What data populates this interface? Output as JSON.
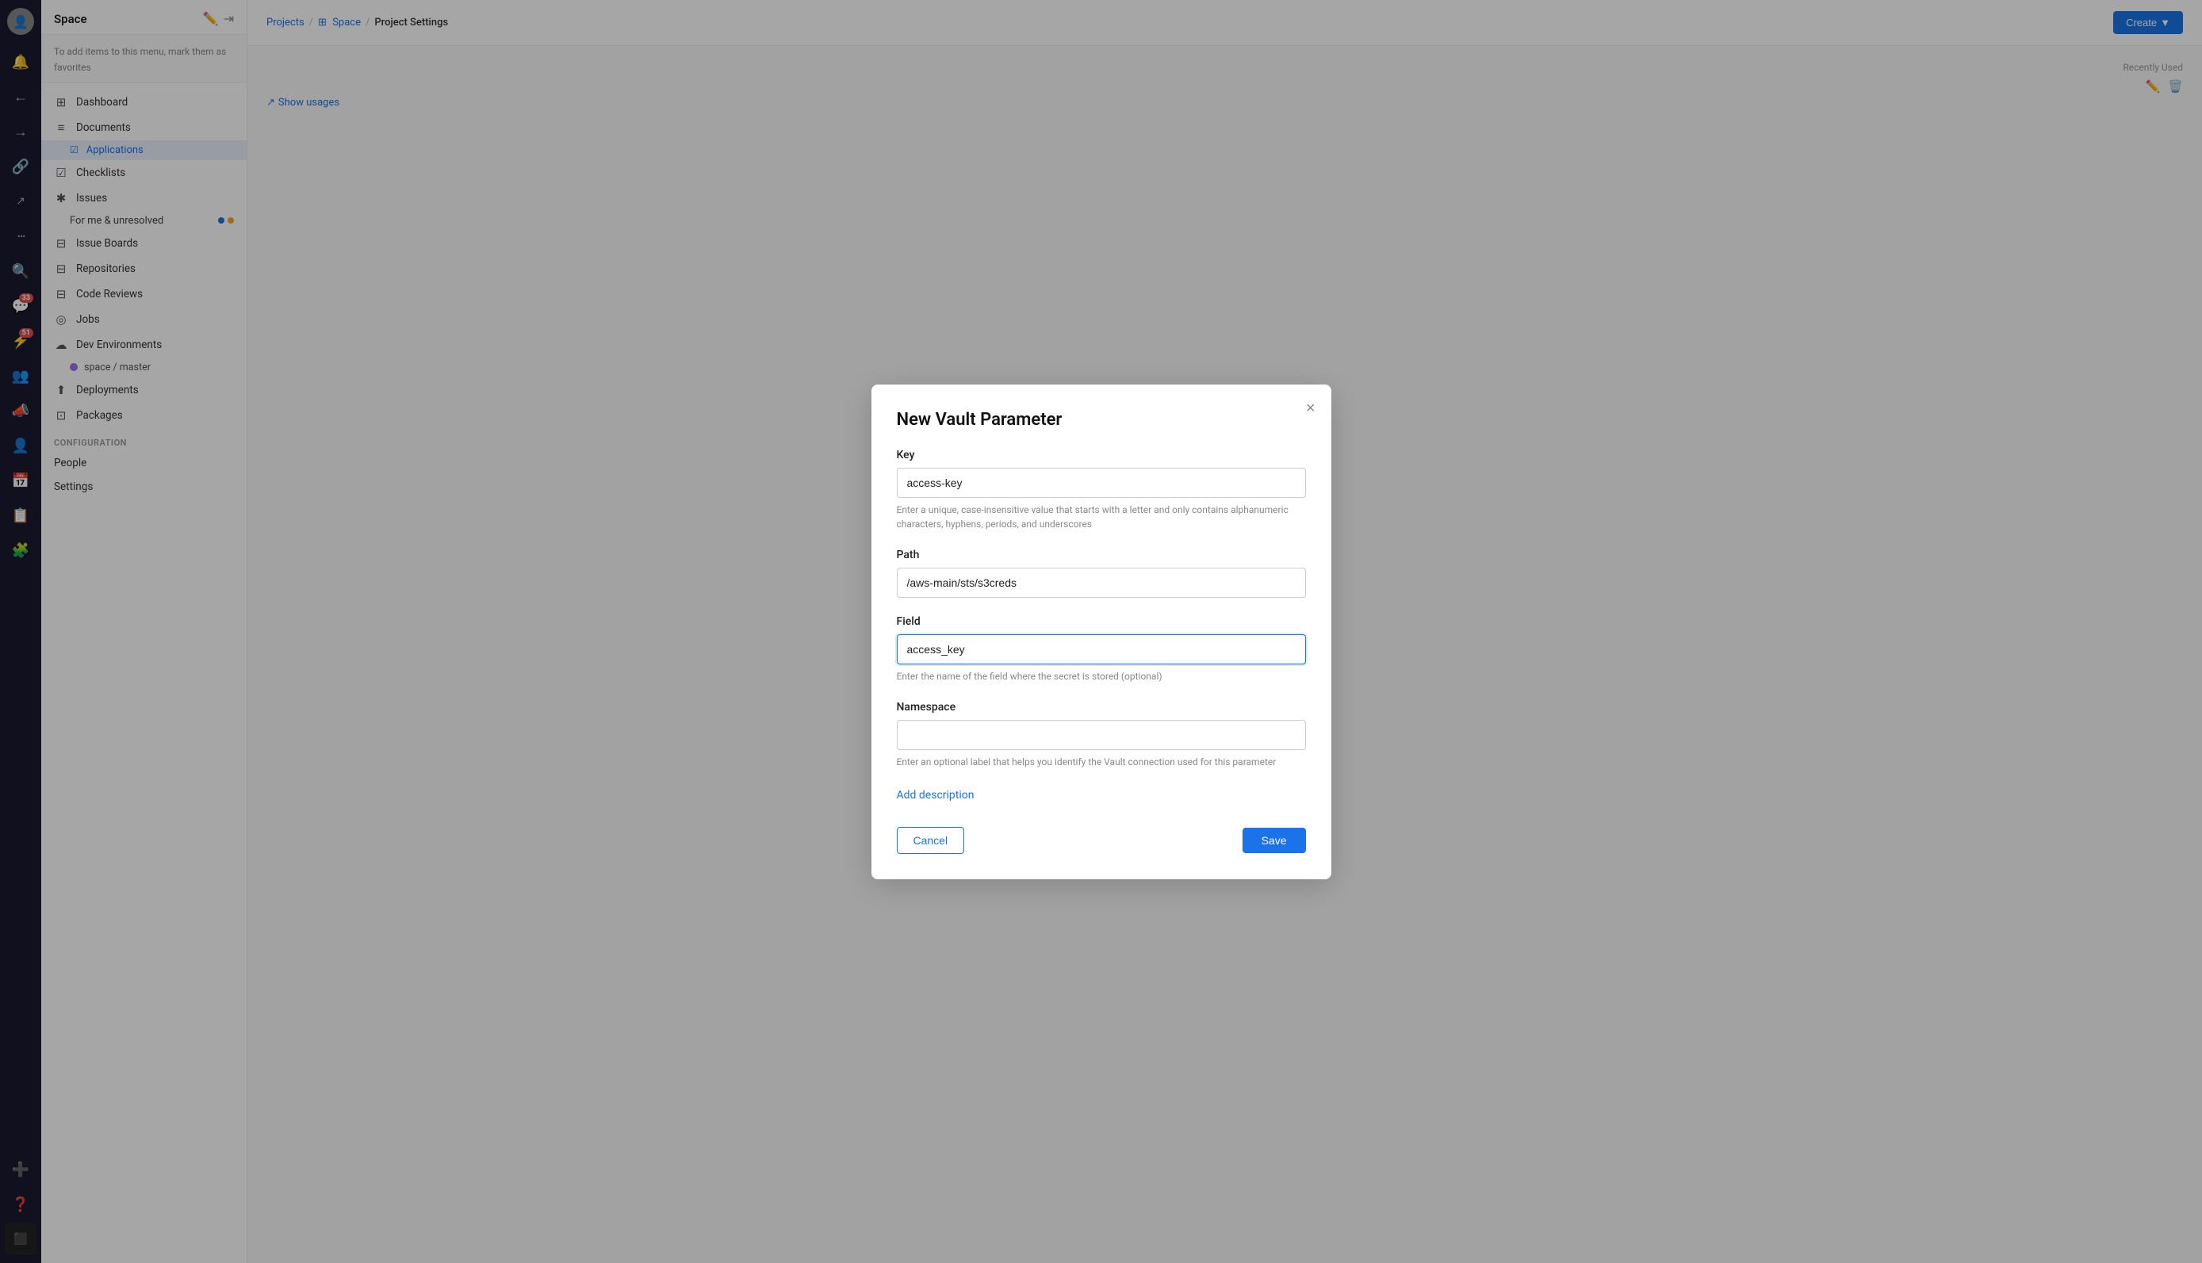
{
  "iconBar": {
    "avatar": "👤",
    "items": [
      {
        "name": "bell-icon",
        "icon": "🔔",
        "badge": null
      },
      {
        "name": "arrow-left-icon",
        "icon": "←",
        "badge": null
      },
      {
        "name": "arrow-right-icon",
        "icon": "→",
        "badge": null
      },
      {
        "name": "link-icon",
        "icon": "🔗",
        "badge": null
      },
      {
        "name": "external-link-icon",
        "icon": "↗",
        "badge": null
      },
      {
        "name": "dots-icon",
        "icon": "···",
        "badge": null
      },
      {
        "name": "search-icon",
        "icon": "🔍",
        "badge": null
      },
      {
        "name": "chat-icon",
        "icon": "💬",
        "badge": "33"
      },
      {
        "name": "lightning-icon",
        "icon": "⚡",
        "badge": "51"
      },
      {
        "name": "people-icon",
        "icon": "👥",
        "badge": null
      },
      {
        "name": "megaphone-icon",
        "icon": "📣",
        "badge": null
      },
      {
        "name": "group-icon",
        "icon": "👤",
        "badge": null
      },
      {
        "name": "calendar-icon",
        "icon": "📅",
        "badge": null
      },
      {
        "name": "list-icon",
        "icon": "📋",
        "badge": null
      },
      {
        "name": "puzzle-icon",
        "icon": "🧩",
        "badge": null
      },
      {
        "name": "plus-circle-icon",
        "icon": "➕",
        "badge": null
      },
      {
        "name": "question-icon",
        "icon": "❓",
        "badge": null
      },
      {
        "name": "black-square-icon",
        "icon": "⬛",
        "badge": null
      }
    ]
  },
  "sidebar": {
    "title": "Space",
    "favoritesText": "To add items to this menu, mark them as favorites",
    "navItems": [
      {
        "icon": "⊞",
        "label": "Dashboard",
        "name": "dashboard"
      },
      {
        "icon": "≡",
        "label": "Documents",
        "name": "documents"
      },
      {
        "icon": "☑",
        "label": "Applications",
        "name": "applications",
        "sub": true
      },
      {
        "icon": "☑",
        "label": "Checklists",
        "name": "checklists"
      },
      {
        "icon": "✱",
        "label": "Issues",
        "name": "issues"
      },
      {
        "icon": "⊟",
        "label": "Issue Boards",
        "name": "issue-boards"
      },
      {
        "icon": "⊟",
        "label": "Repositories",
        "name": "repositories"
      },
      {
        "icon": "⊟",
        "label": "Code Reviews",
        "name": "code-reviews"
      },
      {
        "icon": "◎",
        "label": "Jobs",
        "name": "jobs"
      },
      {
        "icon": "☁",
        "label": "Dev Environments",
        "name": "dev-environments"
      },
      {
        "icon": "⬆",
        "label": "Deployments",
        "name": "deployments"
      },
      {
        "icon": "⊡",
        "label": "Packages",
        "name": "packages"
      }
    ],
    "issuesSub": "For me & unresolved",
    "devEnvSub": "space / master",
    "configSection": "Configuration",
    "configItems": [
      {
        "label": "People",
        "name": "people"
      },
      {
        "label": "Settings",
        "name": "settings"
      }
    ]
  },
  "breadcrumb": {
    "projects": "Projects",
    "space": "Space",
    "spaceIcon": "⊞",
    "projectSettings": "Project Settings",
    "separator": "/"
  },
  "toolbar": {
    "createLabel": "Create",
    "dropdownIcon": "▼"
  },
  "recentlyUsed": {
    "label": "Recently Used",
    "showUsages": "Show usages",
    "showUsagesIcon": "↗"
  },
  "modal": {
    "title": "New Vault Parameter",
    "closeIcon": "×",
    "fields": {
      "key": {
        "label": "Key",
        "value": "access-key",
        "hint": "Enter a unique, case-insensitive value that starts with a letter and only contains alphanumeric characters, hyphens, periods, and underscores"
      },
      "path": {
        "label": "Path",
        "value": "/aws-main/sts/s3creds",
        "hint": ""
      },
      "field": {
        "label": "Field",
        "value": "access_key",
        "hint": "Enter the name of the field where the secret is stored (optional)"
      },
      "namespace": {
        "label": "Namespace",
        "value": "",
        "placeholder": "",
        "hint": "Enter an optional label that helps you identify the Vault connection used for this parameter"
      }
    },
    "addDescription": "Add description",
    "cancelLabel": "Cancel",
    "saveLabel": "Save"
  }
}
